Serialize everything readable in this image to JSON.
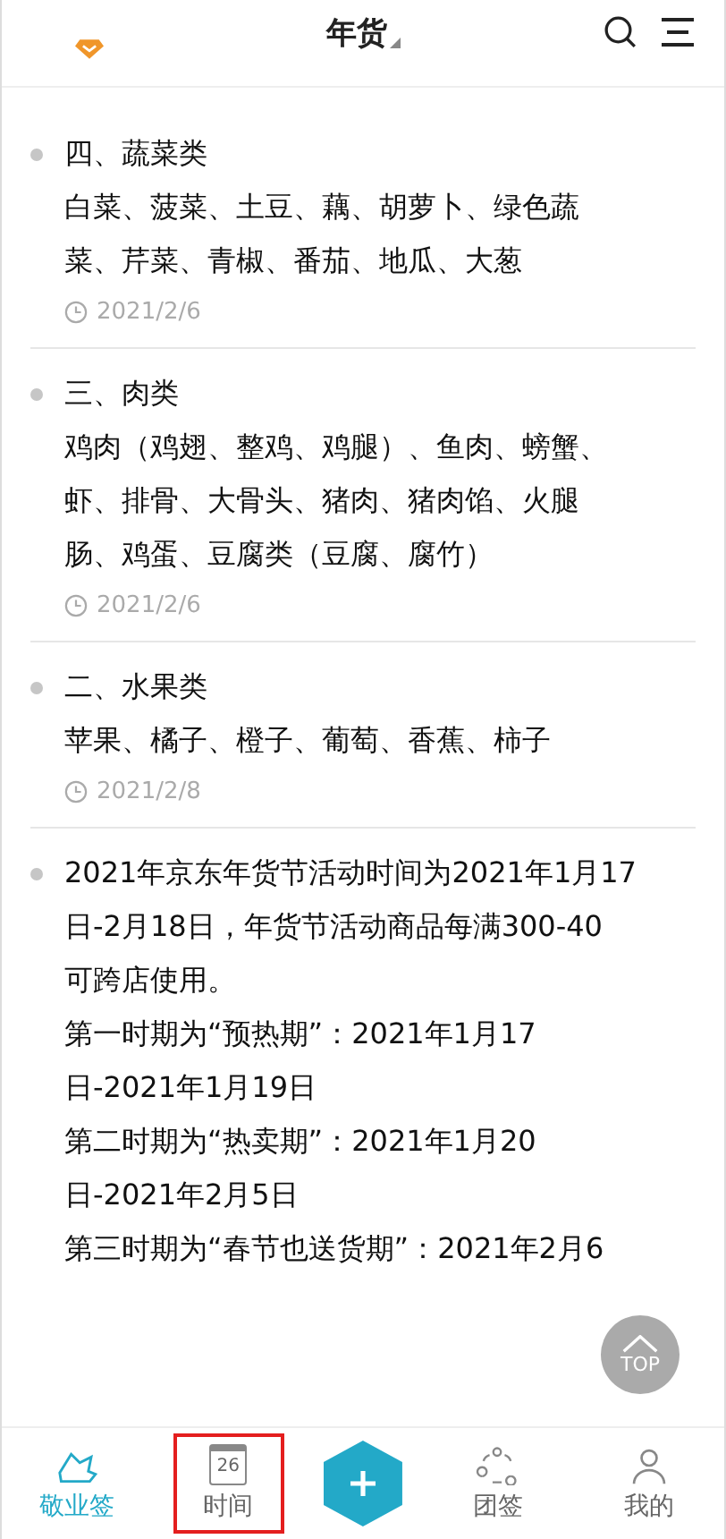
{
  "header": {
    "title": "年货"
  },
  "notes": [
    {
      "title": "四、蔬菜类",
      "lines": [
        "白菜、菠菜、土豆、藕、胡萝卜、绿色蔬",
        "菜、芹菜、青椒、番茄、地瓜、大葱"
      ],
      "date": "2021/2/6"
    },
    {
      "title": "三、肉类",
      "lines": [
        "鸡肉（鸡翅、整鸡、鸡腿）、鱼肉、螃蟹、",
        "虾、排骨、大骨头、猪肉、猪肉馅、火腿",
        "肠、鸡蛋、豆腐类（豆腐、腐竹）"
      ],
      "date": "2021/2/6"
    },
    {
      "title": "二、水果类",
      "lines": [
        "苹果、橘子、橙子、葡萄、香蕉、柿子"
      ],
      "date": "2021/2/8"
    },
    {
      "lines": [
        "2021年京东年货节活动时间为2021年1月17",
        "日-2月18日，年货节活动商品每满300-40",
        "可跨店使用。",
        "第一时期为“预热期”：2021年1月17",
        "日-2021年1月19日",
        "第二时期为“热卖期”：2021年1月20",
        "日-2021年2月5日",
        "第三时期为“春节也送货期”：2021年2月6"
      ]
    }
  ],
  "top_button": {
    "label": "TOP"
  },
  "tabs": [
    {
      "kind": "notes",
      "label": "敬业签",
      "selected": true,
      "highlighted": false
    },
    {
      "kind": "calendar",
      "label": "时间",
      "day": "26",
      "selected": false,
      "highlighted": true
    },
    {
      "kind": "add"
    },
    {
      "kind": "team",
      "label": "团签",
      "selected": false,
      "highlighted": false
    },
    {
      "kind": "profile",
      "label": "我的",
      "selected": false,
      "highlighted": false
    }
  ]
}
